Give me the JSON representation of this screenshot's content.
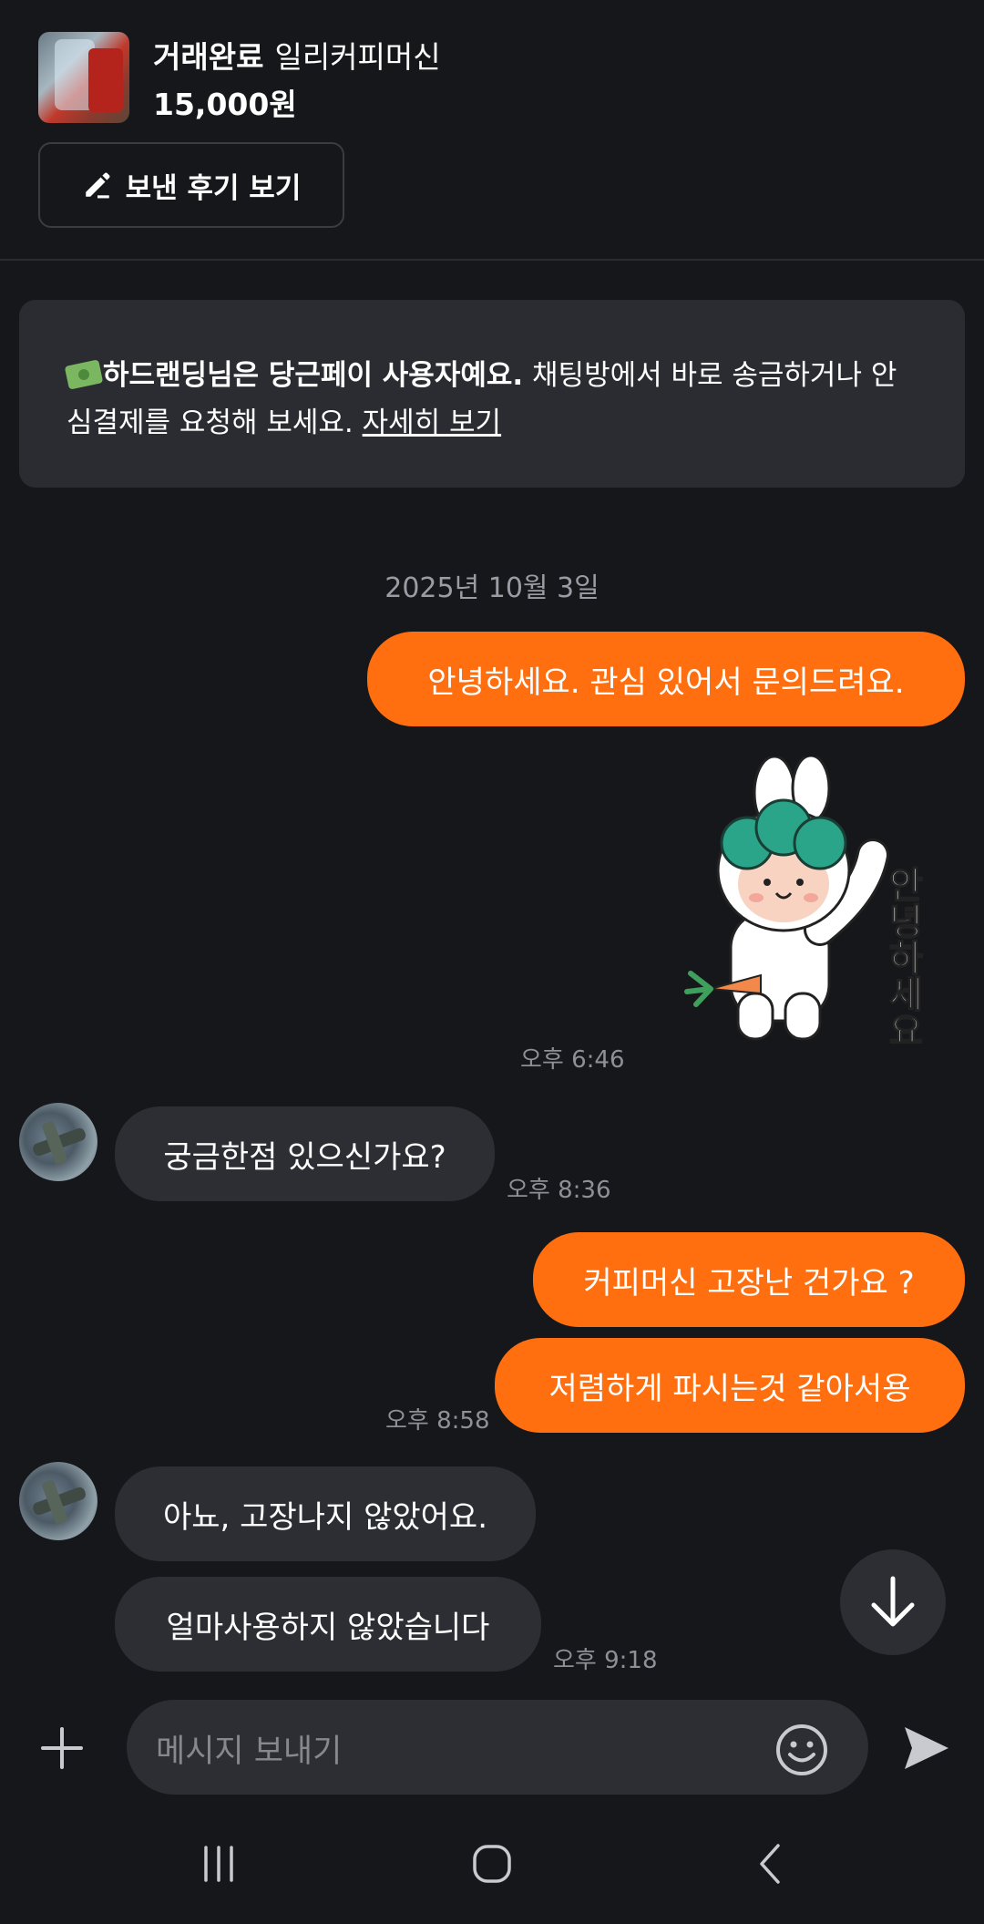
{
  "product": {
    "status": "거래완료",
    "name": "일리커피머신",
    "price": "15,000원",
    "review_button": "보낸 후기 보기"
  },
  "notice": {
    "bold": "하드랜딩님은 당근페이 사용자예요.",
    "text": " 채팅방에서 바로 송금하거나 안심결제를 요청해 보세요. ",
    "link": "자세히 보기"
  },
  "date_separator": "2025년 10월 3일",
  "messages": {
    "m1": "안녕하세요. 관심 있어서 문의드려요.",
    "sticker_text": "안녕하세요",
    "t1": "오후 6:46",
    "m2": "궁금한점 있으신가요?",
    "t2": "오후 8:36",
    "m3": "커피머신 고장난 건가요 ?",
    "m4": "저렴하게 파시는것 같아서용",
    "t3": "오후 8:58",
    "m5": "아뇨, 고장나지 않았어요.",
    "m6": "얼마사용하지 않았습니다",
    "t4": "오후 9:18"
  },
  "input": {
    "placeholder": "메시지 보내기"
  },
  "icons": {
    "add": "plus-icon",
    "emoji": "emoji-icon",
    "send": "send-icon",
    "scroll": "arrow-down-icon",
    "edit": "pencil-icon"
  },
  "colors": {
    "accent": "#ff6f0f",
    "background": "#16171b",
    "bubble_other": "#2c2e33"
  }
}
